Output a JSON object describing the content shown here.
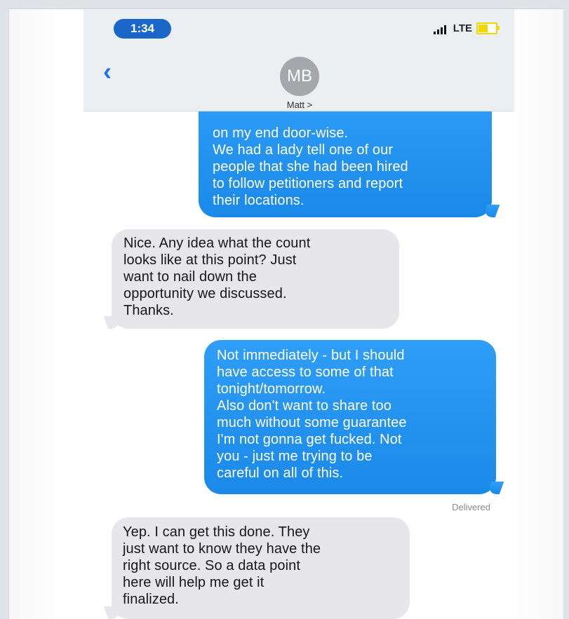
{
  "status_bar": {
    "time": "1:34",
    "network": "LTE"
  },
  "header": {
    "back_icon": "‹",
    "avatar_initials": "MB",
    "contact_name": "Matt >"
  },
  "messages": [
    {
      "direction": "outgoing",
      "text": "on my end door-wise.\nWe had a lady tell one of our\npeople that she had been hired\nto follow petitioners and report\ntheir locations."
    },
    {
      "direction": "incoming",
      "text": "Nice. Any idea what the count\nlooks like at this point? Just\nwant to nail down the\nopportunity we discussed.\nThanks."
    },
    {
      "direction": "outgoing",
      "text": "Not immediately - but I should\nhave access to some of that\ntonight/tomorrow.\nAlso don't want to share too\nmuch without some guarantee\nI'm not gonna get fucked. Not\nyou - just me trying to be\ncareful on all of this."
    },
    {
      "direction": "incoming",
      "text": "Yep. I can get this done. They\njust want to know they have the\nright source. So a data point\nhere will help me get it\nfinalized."
    }
  ],
  "delivery_status": "Delivered",
  "colors": {
    "outgoing_bubble": "#2f9ef8",
    "incoming_bubble": "#e6e6eb",
    "time_pill": "#1b67c9",
    "back_icon": "#1a73e8"
  },
  "icons": {
    "signal": "signal-bars-icon",
    "battery": "battery-charging-icon",
    "back": "back-chevron-icon"
  }
}
